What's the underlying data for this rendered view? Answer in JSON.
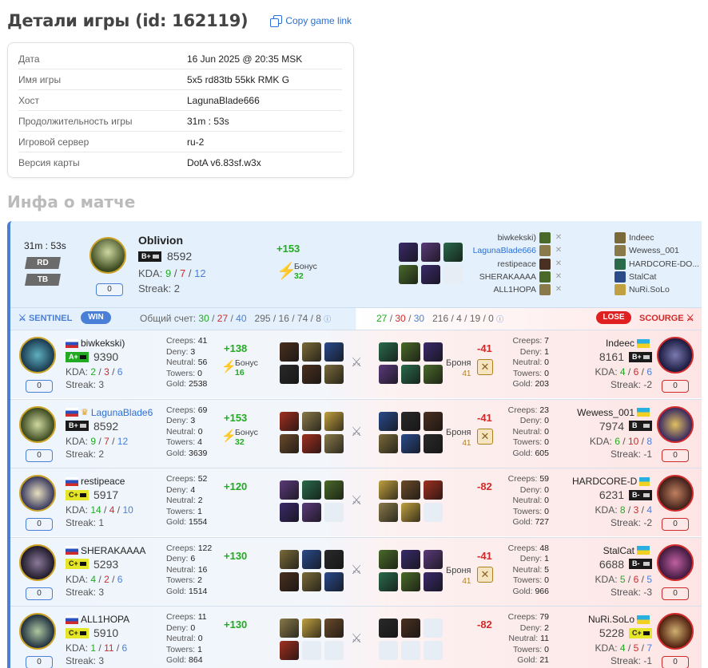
{
  "header": {
    "title": "Детали игры (id: 162119)",
    "copy_link": "Copy game link"
  },
  "details": [
    {
      "k": "Дата",
      "v": "16 Jun 2025 @ 20:35 MSK"
    },
    {
      "k": "Имя игры",
      "v": "5x5 rd83tb 55kk RMK G"
    },
    {
      "k": "Хост",
      "v": "LagunaBlade666"
    },
    {
      "k": "Продолжительность игры",
      "v": "31m : 53s"
    },
    {
      "k": "Игровой сервер",
      "v": "ru-2"
    },
    {
      "k": "Версия карты",
      "v": "DotA v6.83sf.w3x"
    }
  ],
  "match_title": "Инфа о матче",
  "summary": {
    "duration": "31m : 53s",
    "mode1": "RD",
    "mode2": "TB",
    "player": "Oblivion",
    "rank": "B+",
    "elo": "8592",
    "kda_label": "KDA:",
    "k": "9",
    "d": "7",
    "a": "12",
    "streak": "Streak: 2",
    "avatar_rank": "0",
    "delta": "+153",
    "bonus_label": "Бонус",
    "bonus": "32"
  },
  "lineup": {
    "sentinel": [
      "biwkekski)",
      "LagunaBlade666",
      "restipeace",
      "SHERAKAAAA",
      "ALL1HOPA"
    ],
    "scourge": [
      "Indeec",
      "Wewess_001",
      "HARDCORE-DO...",
      "StalCat",
      "NuRi.SoLo"
    ]
  },
  "bar": {
    "sentinel": "SENTINEL",
    "win": "WIN",
    "total_label": "Общий счет:",
    "s_k": "30",
    "s_d": "27",
    "s_a": "40",
    "s_extra": "295 / 16 / 74 / 8",
    "sc_k": "27",
    "sc_d": "30",
    "sc_a": "30",
    "sc_extra": "216 / 4 / 19 / 0",
    "lose": "LOSE",
    "scourge": "SCOURGE"
  },
  "labels": {
    "creeps": "Creeps:",
    "deny": "Deny:",
    "neutral": "Neutral:",
    "towers": "Towers:",
    "gold": "Gold:",
    "kda": "KDA:",
    "bonus": "Бонус",
    "armor": "Броня"
  },
  "rows": [
    {
      "s": {
        "name": "biwkekski)",
        "rank": "A+",
        "elo": "9390",
        "k": "2",
        "d": "3",
        "a": "6",
        "streak": "Streak: 3",
        "av": "0",
        "creeps": "41",
        "deny": "3",
        "neutral": "56",
        "towers": "0",
        "gold": "2538",
        "delta": "+138",
        "bonus": "16"
      },
      "c": {
        "name": "Indeec",
        "rank": "B+",
        "elo": "8161",
        "k": "4",
        "d": "6",
        "a": "6",
        "streak": "Streak: -2",
        "av": "0",
        "creeps": "7",
        "deny": "1",
        "neutral": "0",
        "towers": "0",
        "gold": "203",
        "delta": "-41",
        "armor": "41"
      }
    },
    {
      "s": {
        "name": "LagunaBlade6",
        "rank": "B+",
        "elo": "8592",
        "k": "9",
        "d": "7",
        "a": "12",
        "streak": "Streak: 2",
        "av": "0",
        "creeps": "69",
        "deny": "3",
        "neutral": "0",
        "towers": "4",
        "gold": "3639",
        "delta": "+153",
        "bonus": "32"
      },
      "c": {
        "name": "Wewess_001",
        "rank": "B",
        "elo": "7974",
        "k": "6",
        "d": "10",
        "a": "8",
        "streak": "Streak: -1",
        "av": "0",
        "creeps": "23",
        "deny": "0",
        "neutral": "0",
        "towers": "0",
        "gold": "605",
        "delta": "-41",
        "armor": "41"
      }
    },
    {
      "s": {
        "name": "restipeace",
        "rank": "C+",
        "elo": "5917",
        "k": "14",
        "d": "4",
        "a": "10",
        "streak": "Streak: 1",
        "av": "0",
        "creeps": "52",
        "deny": "4",
        "neutral": "2",
        "towers": "1",
        "gold": "1554",
        "delta": "+120"
      },
      "c": {
        "name": "HARDCORE-D",
        "rank": "B-",
        "elo": "6231",
        "k": "8",
        "d": "3",
        "a": "4",
        "streak": "Streak: -2",
        "av": "0",
        "creeps": "59",
        "deny": "0",
        "neutral": "0",
        "towers": "0",
        "gold": "727",
        "delta": "-82"
      }
    },
    {
      "s": {
        "name": "SHERAKAAAA",
        "rank": "C+",
        "elo": "5293",
        "k": "4",
        "d": "2",
        "a": "6",
        "streak": "Streak: 3",
        "av": "0",
        "creeps": "122",
        "deny": "6",
        "neutral": "16",
        "towers": "2",
        "gold": "1514",
        "delta": "+130"
      },
      "c": {
        "name": "StalCat",
        "rank": "B-",
        "elo": "6688",
        "k": "5",
        "d": "6",
        "a": "5",
        "streak": "Streak: -3",
        "av": "0",
        "creeps": "48",
        "deny": "1",
        "neutral": "5",
        "towers": "0",
        "gold": "966",
        "delta": "-41",
        "armor": "41"
      }
    },
    {
      "s": {
        "name": "ALL1HOPA",
        "rank": "C+",
        "elo": "5910",
        "k": "1",
        "d": "11",
        "a": "6",
        "streak": "Streak: 3",
        "av": "0",
        "creeps": "11",
        "deny": "0",
        "neutral": "0",
        "towers": "1",
        "gold": "864",
        "delta": "+130"
      },
      "c": {
        "name": "NuRi.SoLo",
        "rank": "C+",
        "elo": "5228",
        "k": "4",
        "d": "5",
        "a": "7",
        "streak": "Streak: -1",
        "av": "0",
        "creeps": "79",
        "deny": "2",
        "neutral": "11",
        "towers": "0",
        "gold": "21",
        "delta": "-82"
      }
    }
  ],
  "colors": {
    "accent": "#4a7fd8",
    "win": "#22aa22",
    "loss": "#d02a2a"
  }
}
